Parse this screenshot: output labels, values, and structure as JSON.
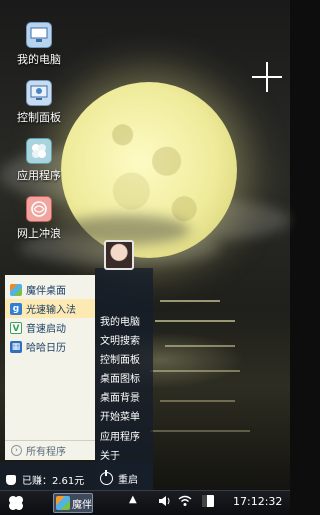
{
  "desktop": {
    "icons": [
      {
        "label": "我的电脑",
        "icon": "computer-icon"
      },
      {
        "label": "控制面板",
        "icon": "control-panel-icon"
      },
      {
        "label": "应用程序",
        "icon": "app-icon"
      },
      {
        "label": "网上冲浪",
        "icon": "browser-icon"
      }
    ]
  },
  "start_menu": {
    "programs": [
      {
        "label": "魔伴桌面",
        "icon": "mobile-desktop-icon",
        "color": "#e98a2b"
      },
      {
        "label": "光速输入法",
        "icon": "input-method-icon",
        "color": "#2f7fd6"
      },
      {
        "label": "音速启动",
        "icon": "launcher-icon",
        "color": "#3aa35a"
      },
      {
        "label": "哈哈日历",
        "icon": "calendar-icon",
        "color": "#2f6fbf"
      }
    ],
    "all_programs": "所有程序",
    "links": [
      "我的电脑",
      "文明搜索",
      "控制面板",
      "桌面图标",
      "桌面背景",
      "开始菜单",
      "应用程序",
      "关于"
    ],
    "earned": "已赚：2.61元",
    "restart": "重启"
  },
  "taskbar": {
    "task_label": "魔伴",
    "clock": "17:12:32"
  }
}
